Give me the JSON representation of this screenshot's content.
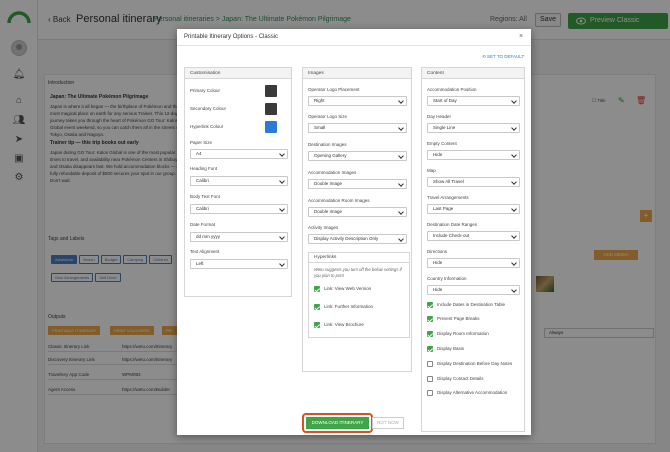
{
  "app": {
    "back_label": "Back",
    "page_title": "Personal itinerary",
    "breadcrumb": "Personal itineraries  >  Japan: The Ultimate Pokémon Pilgrimage",
    "regions": "Regions: All",
    "save_label": "Save",
    "preview_label": "Preview Classic",
    "intro_label": "Introduction",
    "intro_title": "Japan: The Ultimate Pokémon Pilgrimage",
    "intro_text": "Japan is where it all began — the birthplace of Pokémon and the most magical place on earth for any serious Trainer. This 12-day journey takes you through the heart of Pokémon GO Tour: Kalos Global event weekend, so you can catch them all in the streets of Tokyo, Osaka and Nagoya.",
    "intro_sub": "Trainer tip — this trip books out early",
    "intro_text2": "Japan during GO Tour: Kalos Global is one of the most popular times to travel, and availability near Pokémon Centers in Shibuya and Osaka disappears fast. We hold accommodation blocks — a fully refundable deposit of $500 secures your spot in our group. Don't wait.",
    "tags_label": "Tags and Labels",
    "tags": [
      "Adventure",
      "Beach",
      "Budget",
      "Camping",
      "Children"
    ],
    "tags2": [
      "Own Arrangements",
      "Self Drive"
    ],
    "outputs_label": "Outputs",
    "out_buttons": [
      "PRINTABLE ITINERARY",
      "PRINT VOUCHERS",
      "PRI"
    ],
    "out_rows": [
      {
        "label": "Classic Itinerary Link",
        "value": "https://wetu.com/Itinerary"
      },
      {
        "label": "Discovery Itinerary Link",
        "value": "https://wetu.com/Itinerary"
      },
      {
        "label": "TravelKey App Code",
        "value": "WPM083"
      },
      {
        "label": "Agent Access",
        "value": "https://wetu.com/Builder"
      }
    ],
    "add_media": "ADD MEDIA",
    "always": "Always",
    "title_chk": "Title"
  },
  "modal": {
    "title": "Printable Itinerary Options - Classic",
    "close": "×",
    "reset": "SET TO DEFAULT",
    "customisation": {
      "header": "Customisation",
      "primary_colour": "Primary Colour",
      "secondary_colour": "Secondary Colour",
      "hyperlink_colour": "Hyperlink Colour",
      "primary_hex": "#3a3a3a",
      "secondary_hex": "#3a3a3a",
      "hyperlink_hex": "#2a7bd6",
      "paper_size_label": "Paper Size",
      "paper_size": "A4",
      "heading_font_label": "Heading Font",
      "heading_font": "Calibri",
      "body_font_label": "Body Text Font",
      "body_font": "Calibri",
      "date_format_label": "Date Format",
      "date_format": "dd mm yyyy",
      "text_align_label": "Text Alignment",
      "text_align": "Left"
    },
    "images": {
      "header": "Images",
      "logo_placement_label": "Operator Logo Placement",
      "logo_placement": "Right",
      "logo_size_label": "Operator Logo Size",
      "logo_size": "Small",
      "dest_images_label": "Destination Images",
      "dest_images": "Opening Gallery",
      "acc_images_label": "Accommodation Images",
      "acc_images": "Double Image",
      "acc_room_label": "Accommodation Room Images",
      "acc_room": "Double Image",
      "activity_label": "Activity Images",
      "activity": "Display Activity Description Only",
      "hyperlinks_header": "Hyperlinks",
      "hyperlinks_note": "Wetu suggests you turn off the below settings if you plan to print",
      "links": [
        "Link: View Web Version",
        "Link: Further Information",
        "Link: View Brochure"
      ]
    },
    "content": {
      "header": "Content",
      "acc_pos_label": "Accommodation Position",
      "acc_pos": "Start of Day",
      "day_header_label": "Day Header",
      "day_header": "Single Line",
      "empty_content_label": "Empty Content",
      "empty_content": "Hide",
      "map_label": "Map",
      "map": "Show All Travel",
      "travel_arr_label": "Travel Arrangements",
      "travel_arr": "Last Page",
      "dest_dates_label": "Destination Date Ranges",
      "dest_dates": "Include Check-out",
      "directions_label": "Directions",
      "directions": "Hide",
      "country_info_label": "Country Information",
      "country_info": "Hide",
      "checks": [
        {
          "label": "Include Dates in Destination Table",
          "on": true
        },
        {
          "label": "Prevent Page Breaks",
          "on": true
        },
        {
          "label": "Display Room Information",
          "on": true
        },
        {
          "label": "Display Basis",
          "on": true
        },
        {
          "label": "Display Destination Before Day Notes",
          "on": false
        },
        {
          "label": "Display Contact Details",
          "on": false
        },
        {
          "label": "Display Alternative Accommodation",
          "on": false
        }
      ]
    },
    "download_label": "DOWNLOAD ITINERARY",
    "not_now_label": "NOT NOW"
  }
}
